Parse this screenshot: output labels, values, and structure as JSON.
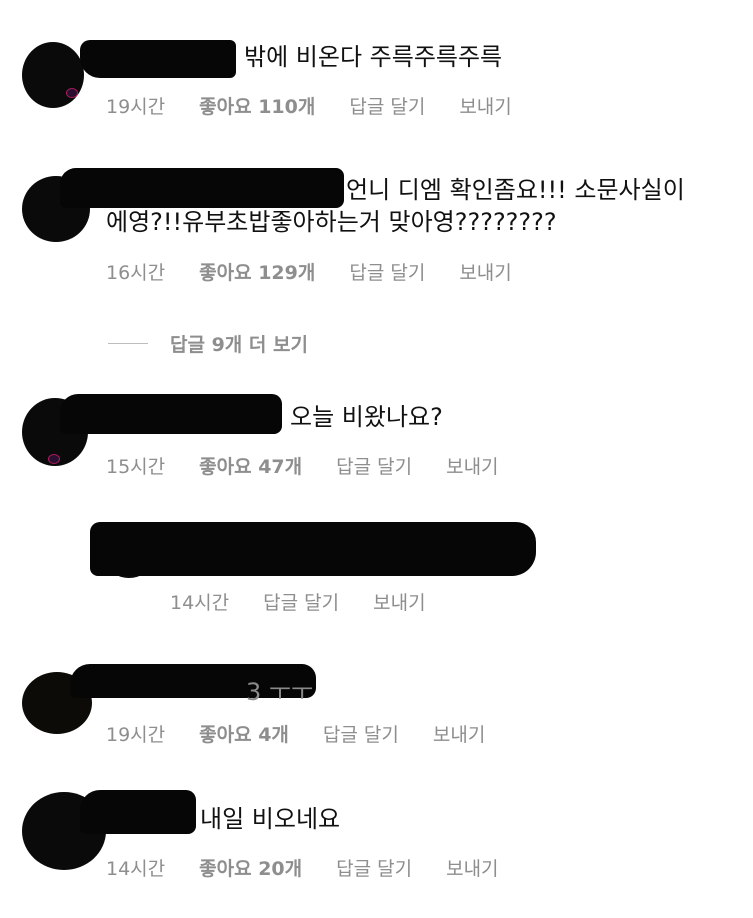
{
  "comments": [
    {
      "text": "밖에 비온다 주륵주륵주륵",
      "time": "19시간",
      "likes": "좋아요 110개",
      "reply": "답글 달기",
      "send": "보내기"
    },
    {
      "text_line1": "언니 디엠 확인좀요!!! 소문사실이",
      "text_line2": "에영?!!유부초밥좋아하는거 맞아영????????",
      "time": "16시간",
      "likes": "좋아요 129개",
      "reply": "답글 달기",
      "send": "보내기"
    },
    {
      "text": "오늘 비왔나요?",
      "time": "15시간",
      "likes": "좋아요 47개",
      "reply": "답글 달기",
      "send": "보내기"
    },
    {
      "time": "14시간",
      "reply": "답글 달기",
      "send": "보내기"
    },
    {
      "text": "3 ㅜㅜ",
      "time": "19시간",
      "likes": "좋아요 4개",
      "reply": "답글 달기",
      "send": "보내기"
    },
    {
      "text": "내일 비오네요",
      "time": "14시간",
      "likes": "좋아요 20개",
      "reply": "답글 달기",
      "send": "보내기"
    }
  ],
  "view_replies": "답글 9개 더 보기"
}
